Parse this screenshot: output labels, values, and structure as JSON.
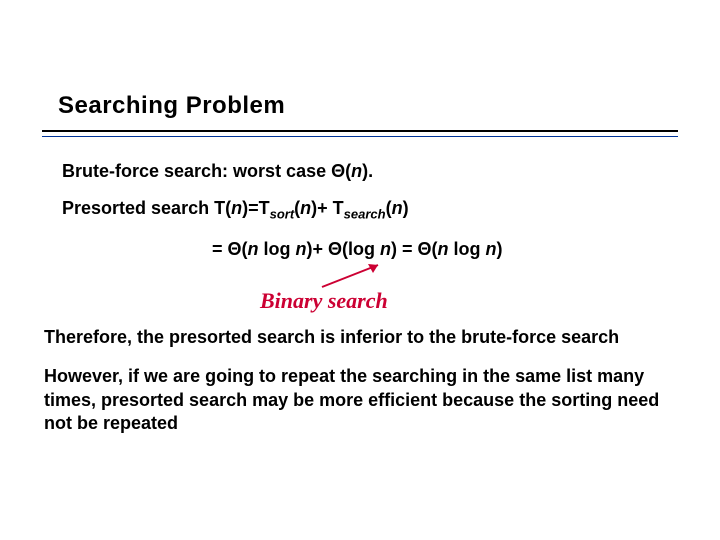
{
  "title": "Searching Problem",
  "line1": {
    "pre": "Brute-force search: worst case Θ(",
    "nvar": "n",
    "post": ")."
  },
  "line2": {
    "pre": "Presorted search T(",
    "nvar1": "n",
    "mid1": ")=T",
    "sub1": "sort",
    "open1": "(",
    "nvar2": "n",
    "close1": ")+ T",
    "sub2": "search",
    "open2": "(",
    "nvar3": "n",
    "close2": ")"
  },
  "eq": {
    "pre": "= Θ(",
    "n1": "n",
    "mid1": " log ",
    "n2": "n",
    "mid2": ")+ Θ(log ",
    "n3": "n",
    "mid3": ") = Θ(",
    "n4": "n",
    "mid4": " log ",
    "n5": "n",
    "post": ")"
  },
  "binary_label": "Binary search",
  "para3": "Therefore, the presorted search is inferior to the brute-force search",
  "para4": "However, if we are going to repeat the searching in the same list many times, presorted search may be more efficient because the sorting need not be repeated"
}
